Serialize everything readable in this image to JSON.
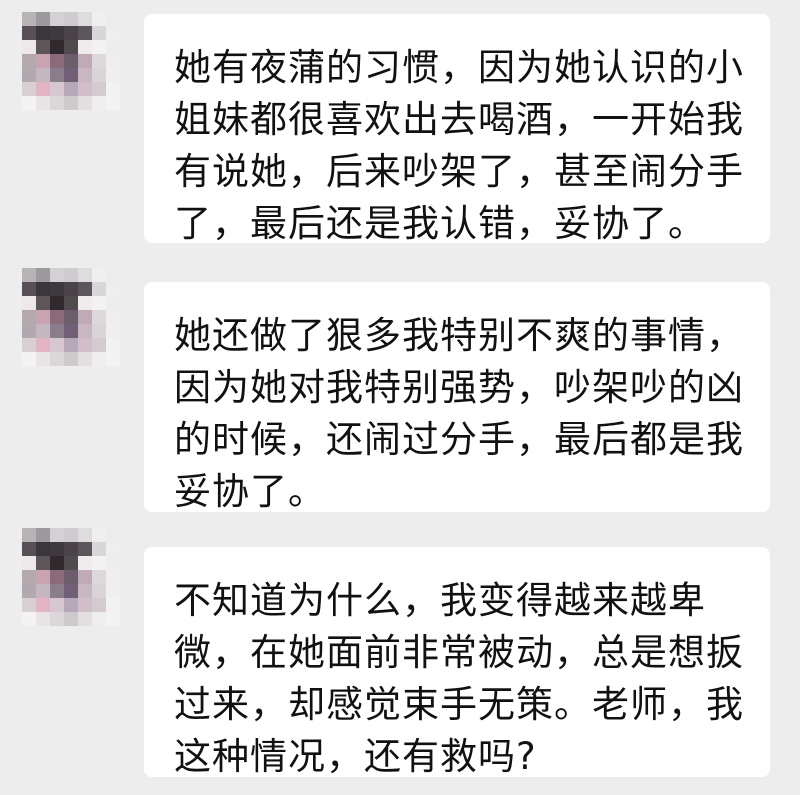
{
  "chat": {
    "messages": [
      {
        "id": "m1",
        "sender": "other",
        "text": "她有夜蒲的习惯，因为她认识的小姐妹都很喜欢出去喝酒，一开始我有说她，后来吵架了，甚至闹分手了，最后还是我认错，妥协了。"
      },
      {
        "id": "m2",
        "sender": "other",
        "text": "她还做了狠多我特别不爽的事情，因为她对我特别强势，吵架吵的凶的时候，还闹过分手，最后都是我妥协了。"
      },
      {
        "id": "m3",
        "sender": "other",
        "text": "不知道为什么，我变得越来越卑微，在她面前非常被动，总是想扳过来，却感觉束手无策。老师，我这种情况，还有救吗?"
      }
    ]
  },
  "colors": {
    "background": "#ededed",
    "bubble": "#ffffff",
    "text": "#111111"
  },
  "icons": {
    "avatar": "pixelated-avatar-icon"
  }
}
